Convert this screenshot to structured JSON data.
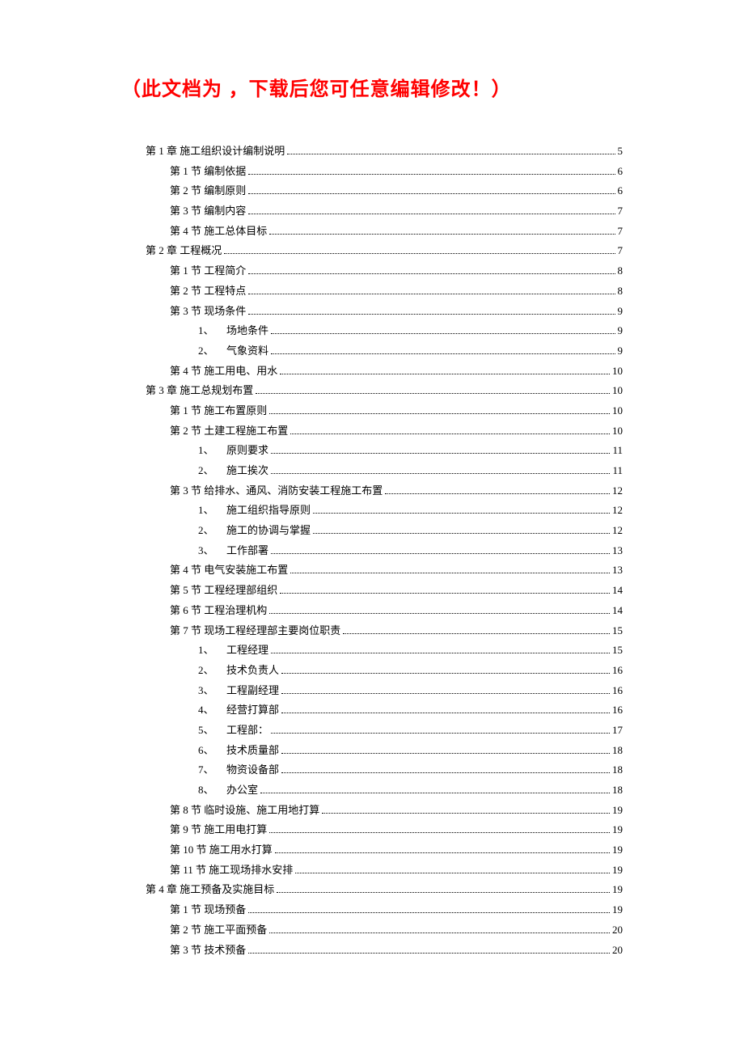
{
  "title": "（此文档为 ，下载后您可任意编辑修改！）",
  "toc": [
    {
      "level": 1,
      "label": "第 1 章  施工组织设计编制说明",
      "page": "5"
    },
    {
      "level": 2,
      "label": "第 1 节  编制依据",
      "page": "6"
    },
    {
      "level": 2,
      "label": "第 2 节  编制原则",
      "page": "6"
    },
    {
      "level": 2,
      "label": "第 3 节  编制内容",
      "page": "7"
    },
    {
      "level": 2,
      "label": "第 4 节  施工总体目标",
      "page": "7"
    },
    {
      "level": 1,
      "label": "第 2 章  工程概况",
      "page": "7"
    },
    {
      "level": 2,
      "label": "第 1 节  工程简介",
      "page": "8"
    },
    {
      "level": 2,
      "label": "第 2 节  工程特点",
      "page": "8"
    },
    {
      "level": 2,
      "label": "第 3 节  现场条件",
      "page": "9"
    },
    {
      "level": 3,
      "num": "1、",
      "label": "场地条件",
      "page": "9"
    },
    {
      "level": 3,
      "num": "2、",
      "label": "气象资料",
      "page": "9"
    },
    {
      "level": 2,
      "label": "第 4 节  施工用电、用水",
      "page": "10"
    },
    {
      "level": 1,
      "label": "第 3 章  施工总规划布置",
      "page": "10"
    },
    {
      "level": 2,
      "label": "第 1 节  施工布置原则",
      "page": "10"
    },
    {
      "level": 2,
      "label": "第 2 节  土建工程施工布置",
      "page": "10"
    },
    {
      "level": 3,
      "num": "1、",
      "label": "原则要求",
      "page": "11"
    },
    {
      "level": 3,
      "num": "2、",
      "label": "施工挨次",
      "page": "11"
    },
    {
      "level": 2,
      "label": "第 3 节  给排水、通风、消防安装工程施工布置",
      "page": "12"
    },
    {
      "level": 3,
      "num": "1、",
      "label": "施工组织指导原则",
      "page": "12"
    },
    {
      "level": 3,
      "num": "2、",
      "label": "施工的协调与掌握",
      "page": "12"
    },
    {
      "level": 3,
      "num": "3、",
      "label": "工作部署",
      "page": "13"
    },
    {
      "level": 2,
      "label": "第 4 节  电气安装施工布置",
      "page": "13"
    },
    {
      "level": 2,
      "label": "第 5 节  工程经理部组织",
      "page": "14"
    },
    {
      "level": 2,
      "label": "第 6 节  工程治理机构",
      "page": "14"
    },
    {
      "level": 2,
      "label": "第 7 节  现场工程经理部主要岗位职责",
      "page": "15"
    },
    {
      "level": 3,
      "num": "1、",
      "label": "工程经理",
      "page": "15"
    },
    {
      "level": 3,
      "num": "2、",
      "label": "技术负责人",
      "page": "16"
    },
    {
      "level": 3,
      "num": "3、",
      "label": "工程副经理",
      "page": "16"
    },
    {
      "level": 3,
      "num": "4、",
      "label": "经营打算部",
      "page": "16"
    },
    {
      "level": 3,
      "num": "5、",
      "label": "工程部：",
      "page": "17"
    },
    {
      "level": 3,
      "num": "6、",
      "label": "技术质量部",
      "page": "18"
    },
    {
      "level": 3,
      "num": "7、",
      "label": "物资设备部",
      "page": "18"
    },
    {
      "level": 3,
      "num": "8、",
      "label": "办公室",
      "page": "18"
    },
    {
      "level": 2,
      "label": "第 8 节  临时设施、施工用地打算",
      "page": "19"
    },
    {
      "level": 2,
      "label": "第 9 节  施工用电打算",
      "page": "19"
    },
    {
      "level": 2,
      "label": "第 10 节  施工用水打算",
      "page": "19"
    },
    {
      "level": 2,
      "label": "第 11 节  施工现场排水安排",
      "page": "19"
    },
    {
      "level": 1,
      "label": "第 4 章  施工预备及实施目标",
      "page": "19"
    },
    {
      "level": 2,
      "label": "第 1 节  现场预备",
      "page": "19"
    },
    {
      "level": 2,
      "label": "第 2 节  施工平面预备",
      "page": "20"
    },
    {
      "level": 2,
      "label": "第 3 节  技术预备",
      "page": "20"
    }
  ]
}
